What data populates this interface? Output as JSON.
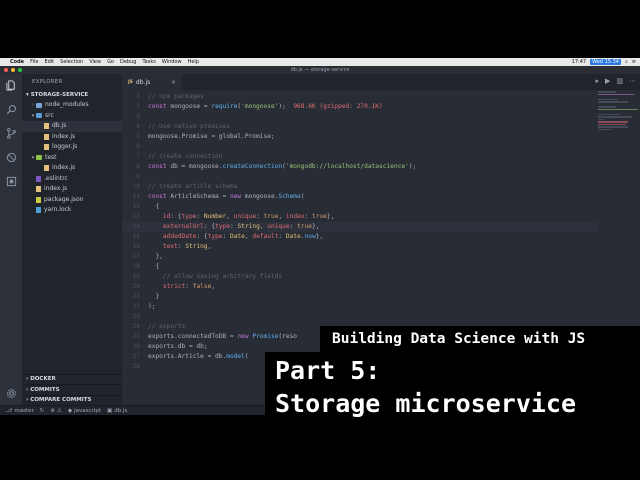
{
  "menubar": {
    "app_name": "Code",
    "items": [
      "File",
      "Edit",
      "Selection",
      "View",
      "Go",
      "Debug",
      "Tasks",
      "Window",
      "Help"
    ],
    "time": "17:47",
    "date_badge": "Wed 15:34"
  },
  "window": {
    "title": "db.js — storage-service"
  },
  "sidebar": {
    "header": "EXPLORER",
    "section": "STORAGE-SERVICE",
    "tree": [
      {
        "label": "node_modules",
        "kind": "folder",
        "depth": 1,
        "expanded": false
      },
      {
        "label": "src",
        "kind": "folder",
        "depth": 1,
        "expanded": true
      },
      {
        "label": "db.js",
        "kind": "js",
        "depth": 2,
        "active": true
      },
      {
        "label": "index.js",
        "kind": "js",
        "depth": 2
      },
      {
        "label": "logger.js",
        "kind": "js",
        "depth": 2
      },
      {
        "label": "test",
        "kind": "folder",
        "depth": 1,
        "expanded": true
      },
      {
        "label": "index.js",
        "kind": "js",
        "depth": 2
      },
      {
        "label": ".eslintrc",
        "kind": "config",
        "depth": 1
      },
      {
        "label": "index.js",
        "kind": "js",
        "depth": 1
      },
      {
        "label": "package.json",
        "kind": "json",
        "depth": 1
      },
      {
        "label": "yarn.lock",
        "kind": "lock",
        "depth": 1
      }
    ],
    "bottom_sections": [
      "DOCKER",
      "COMMITS",
      "COMPARE COMMITS"
    ]
  },
  "tab": {
    "badge": "JS",
    "label": "db.js",
    "close": "×"
  },
  "editor": {
    "lines": [
      [
        [
          "c-com",
          "// npm packages"
        ]
      ],
      [
        [
          "c-kw",
          "const "
        ],
        [
          "code",
          "mongoose = "
        ],
        [
          "c-fn",
          "require"
        ],
        [
          "code",
          "("
        ],
        [
          "c-str",
          "'mongoose'"
        ],
        [
          "code",
          ");  "
        ],
        [
          "c-size",
          "968.6K (gzipped: 270.1K)"
        ]
      ],
      [],
      [
        [
          "c-com",
          "// Use native promises"
        ]
      ],
      [
        [
          "code",
          "mongoose.Promise = global.Promise;"
        ]
      ],
      [],
      [
        [
          "c-com",
          "// create connection"
        ]
      ],
      [
        [
          "c-kw",
          "const "
        ],
        [
          "code",
          "db = mongoose."
        ],
        [
          "c-fn",
          "createConnection"
        ],
        [
          "code",
          "("
        ],
        [
          "c-str",
          "'mongodb://localhost/datascience'"
        ],
        [
          "code",
          ");"
        ]
      ],
      [],
      [
        [
          "c-com",
          "// create article schema"
        ]
      ],
      [
        [
          "c-kw",
          "const "
        ],
        [
          "code",
          "ArticleSchema = "
        ],
        [
          "c-kw",
          "new "
        ],
        [
          "code",
          "mongoose."
        ],
        [
          "c-fn",
          "Schema"
        ],
        [
          "code",
          "("
        ]
      ],
      [
        [
          "code",
          "  {"
        ]
      ],
      [
        [
          "code",
          "    "
        ],
        [
          "c-prop",
          "id"
        ],
        [
          "code",
          ": {"
        ],
        [
          "c-prop",
          "type"
        ],
        [
          "code",
          ": "
        ],
        [
          "c-type",
          "Number"
        ],
        [
          "code",
          ", "
        ],
        [
          "c-prop",
          "unique"
        ],
        [
          "code",
          ": "
        ],
        [
          "c-num",
          "true"
        ],
        [
          "code",
          ", "
        ],
        [
          "c-prop",
          "index"
        ],
        [
          "code",
          ": "
        ],
        [
          "c-num",
          "true"
        ],
        [
          "code",
          "},"
        ]
      ],
      [
        [
          "code",
          "    "
        ],
        [
          "c-prop",
          "externalUrl"
        ],
        [
          "code",
          ": {"
        ],
        [
          "c-prop",
          "type"
        ],
        [
          "code",
          ": "
        ],
        [
          "c-type",
          "String"
        ],
        [
          "code",
          ", "
        ],
        [
          "c-prop",
          "unique"
        ],
        [
          "code",
          ": "
        ],
        [
          "c-num",
          "true"
        ],
        [
          "code",
          "},"
        ]
      ],
      [
        [
          "code",
          "    "
        ],
        [
          "c-prop",
          "addedDate"
        ],
        [
          "code",
          ": {"
        ],
        [
          "c-prop",
          "type"
        ],
        [
          "code",
          ": "
        ],
        [
          "c-type",
          "Date"
        ],
        [
          "code",
          ", "
        ],
        [
          "c-prop",
          "default"
        ],
        [
          "code",
          ": "
        ],
        [
          "c-type",
          "Date"
        ],
        [
          "code",
          "."
        ],
        [
          "c-fn",
          "now"
        ],
        [
          "code",
          "},"
        ]
      ],
      [
        [
          "code",
          "    "
        ],
        [
          "c-prop",
          "text"
        ],
        [
          "code",
          ": "
        ],
        [
          "c-type",
          "String"
        ],
        [
          "code",
          ","
        ]
      ],
      [
        [
          "code",
          "  },"
        ]
      ],
      [
        [
          "code",
          "  {"
        ]
      ],
      [
        [
          "code",
          "    "
        ],
        [
          "c-com",
          "// allow saving arbitrary fields"
        ]
      ],
      [
        [
          "code",
          "    "
        ],
        [
          "c-prop",
          "strict"
        ],
        [
          "code",
          ": "
        ],
        [
          "c-num",
          "false"
        ],
        [
          "code",
          ","
        ]
      ],
      [
        [
          "code",
          "  }"
        ]
      ],
      [
        [
          "code",
          ");"
        ]
      ],
      [],
      [
        [
          "c-com",
          "// exports"
        ]
      ],
      [
        [
          "code",
          "exports.connectedToDB = "
        ],
        [
          "c-kw",
          "new "
        ],
        [
          "c-fn",
          "Promise"
        ],
        [
          "code",
          "(reso"
        ]
      ],
      [
        [
          "code",
          "exports.db = db;"
        ]
      ],
      [
        [
          "code",
          "exports.Article = db."
        ],
        [
          "c-fn",
          "model"
        ],
        [
          "code",
          "("
        ]
      ],
      []
    ],
    "current_line": 14
  },
  "statusbar": {
    "branch": "master",
    "language": "javascript",
    "file": "db.js"
  },
  "overlay": {
    "subtitle": "Building Data Science with JS",
    "title_line1": "Part 5:",
    "title_line2": "Storage microservice"
  },
  "colors": {
    "editor_bg": "#282c34",
    "sidebar_bg": "#21252b",
    "activity_bg": "#2c313a",
    "js_icon": "#e5c07b",
    "folder_icon": "#7aa6da",
    "test_folder_icon": "#8bc34a"
  },
  "icons": {
    "activity": [
      "files-icon",
      "search-icon",
      "source-control-icon",
      "debug-icon",
      "extensions-icon"
    ],
    "settings": "gear-icon"
  }
}
